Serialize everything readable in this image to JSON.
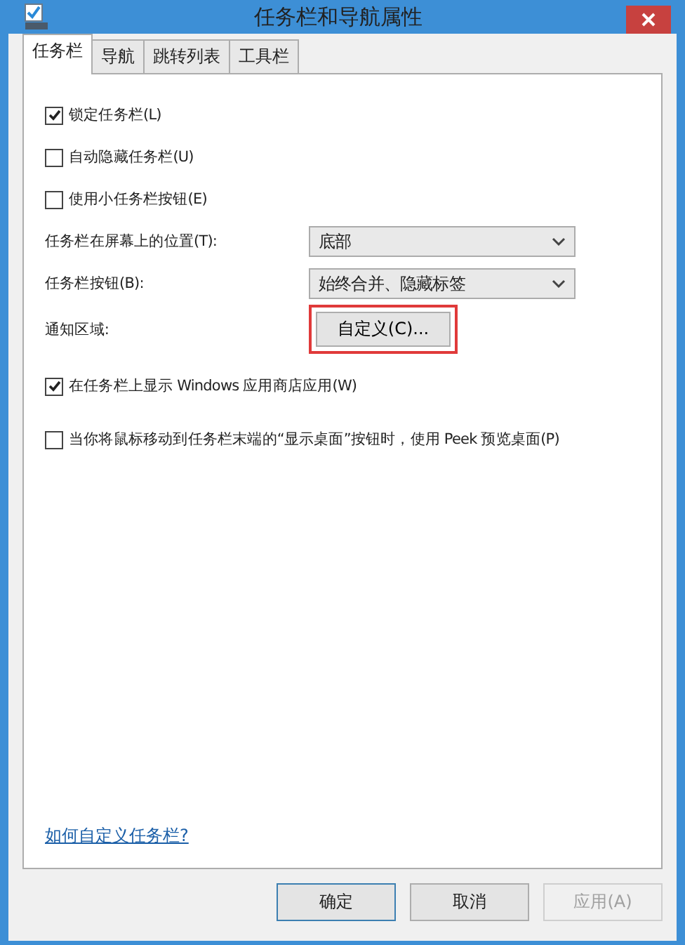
{
  "window": {
    "title": "任务栏和导航属性"
  },
  "tabs": [
    {
      "label": "任务栏",
      "selected": true
    },
    {
      "label": "导航",
      "selected": false
    },
    {
      "label": "跳转列表",
      "selected": false
    },
    {
      "label": "工具栏",
      "selected": false
    }
  ],
  "options": [
    {
      "kind": "checkbox",
      "label": "锁定任务栏(L)",
      "checked": true
    },
    {
      "kind": "checkbox",
      "label": "自动隐藏任务栏(U)",
      "checked": false
    },
    {
      "kind": "checkbox",
      "label": "使用小任务栏按钮(E)",
      "checked": false
    },
    {
      "kind": "dropdown",
      "label": "任务栏在屏幕上的位置(T):",
      "value": "底部"
    },
    {
      "kind": "dropdown",
      "label": "任务栏按钮(B):",
      "value": "始终合并、隐藏标签"
    },
    {
      "kind": "button",
      "label": "通知区域:",
      "button": "自定义(C)...",
      "highlighted": true
    },
    {
      "kind": "checkbox",
      "label": "在任务栏上显示 Windows 应用商店应用(W)",
      "checked": true
    },
    {
      "kind": "checkbox",
      "label": "当你将鼠标移动到任务栏末端的“显示桌面”按钮时，使用 Peek 预览桌面(P)",
      "checked": false
    }
  ],
  "help_link": "如何自定义任务栏?",
  "buttons": [
    {
      "label": "确定",
      "disabled": false,
      "default": true
    },
    {
      "label": "取消",
      "disabled": false,
      "default": false
    },
    {
      "label": "应用(A)",
      "disabled": true,
      "default": false
    }
  ]
}
